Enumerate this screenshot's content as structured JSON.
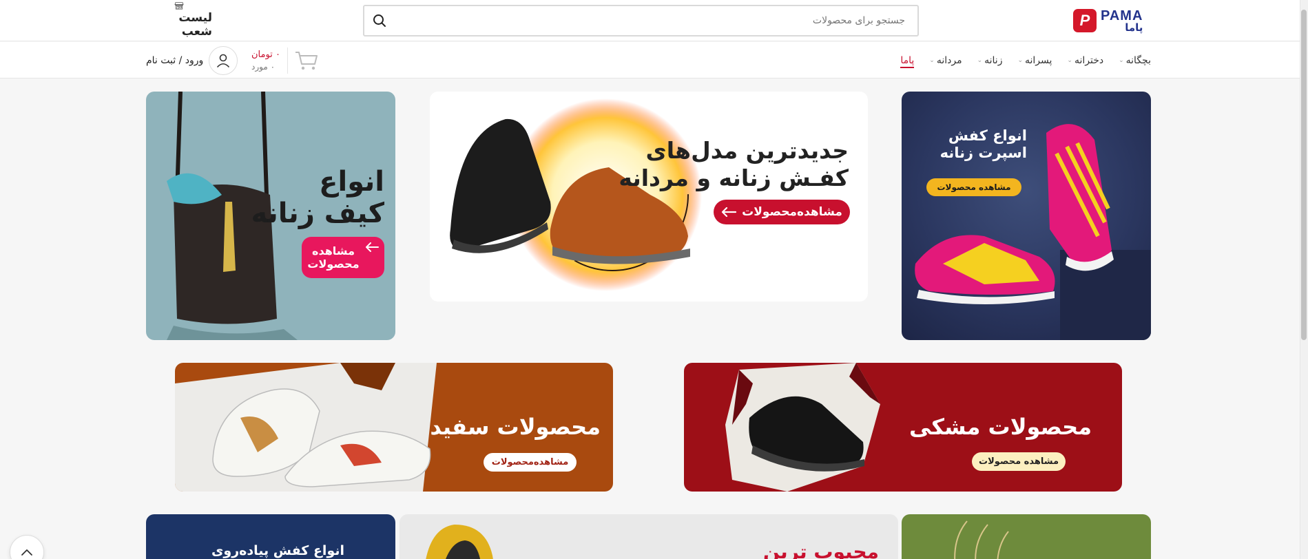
{
  "brand": {
    "logo_latin": "PAMA",
    "logo_fa": "پاما",
    "color": "#d4182a",
    "nav_color": "#23338c"
  },
  "search": {
    "placeholder": "جستجو برای محصولات",
    "value": "جستجو برای محصولات",
    "icon": "search-icon"
  },
  "branches": {
    "label": "لیست شعب",
    "icon": "store-icon"
  },
  "nav": {
    "items": [
      {
        "label": "پاما",
        "active": true,
        "has_dropdown": false
      },
      {
        "label": "مردانه",
        "has_dropdown": true
      },
      {
        "label": "زنانه",
        "has_dropdown": true
      },
      {
        "label": "پسرانه",
        "has_dropdown": true
      },
      {
        "label": "دخترانه",
        "has_dropdown": true
      },
      {
        "label": "بچگانه",
        "has_dropdown": true
      }
    ],
    "active_color": "#c8102e"
  },
  "account": {
    "login_label": "ورود / ثبت نام",
    "icon": "user-icon"
  },
  "cart": {
    "price": "۰ تومان",
    "count": "۰ مورد",
    "icon": "cart-icon"
  },
  "banners": {
    "sport": {
      "title_line1": "انواع کفش",
      "title_line2": "اسپرت زنانه",
      "button": "مشاهده محصولات"
    },
    "newest": {
      "title_line1": "جدیدترین مدل‌های",
      "title_line2": "کفـش زنانه و مردانه",
      "button": "مشاهده‌محصولات"
    },
    "bag": {
      "title_line1": "انواع",
      "title_line2": "کیف زنانه",
      "button_line1": "مشاهده",
      "button_line2": "محصولات"
    },
    "black": {
      "title": "محصولات مشکی",
      "button": "مشاهده محصولات"
    },
    "white": {
      "title": "محصولات سفید",
      "button": "مشاهده‌محصولات"
    },
    "walking": {
      "title": "انواع کفش پیاده‌روی"
    },
    "popular": {
      "title": "محبوب ترین"
    }
  },
  "scroll_top": {
    "icon": "chevron-up-icon"
  }
}
